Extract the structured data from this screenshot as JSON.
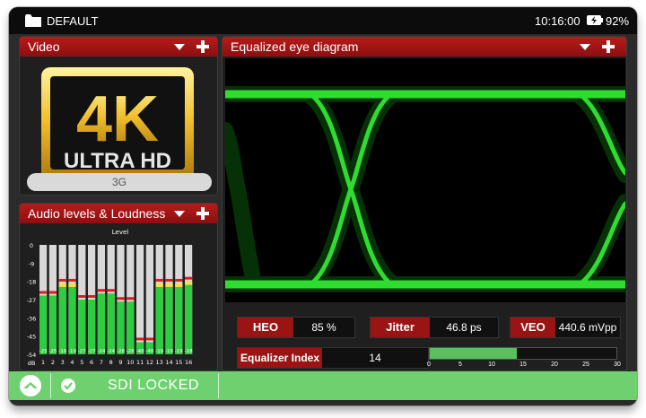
{
  "status": {
    "profile": "DEFAULT",
    "time": "10:16:00",
    "battery": "92%"
  },
  "video": {
    "title": "Video",
    "logo_main": "4K",
    "logo_sub": "ULTRA HD",
    "format": "3G"
  },
  "audio": {
    "title": "Audio levels & Loudness",
    "chart_title": "Level",
    "y_ticks": [
      "0",
      "-9",
      "-18",
      "-27",
      "-36",
      "-45",
      "-54",
      "dB"
    ],
    "channels": [
      {
        "ch": "1",
        "peak": "-25"
      },
      {
        "ch": "2",
        "peak": "-25"
      },
      {
        "ch": "3",
        "peak": "-19"
      },
      {
        "ch": "4",
        "peak": "-19"
      },
      {
        "ch": "5",
        "peak": "-27"
      },
      {
        "ch": "6",
        "peak": "-27"
      },
      {
        "ch": "7",
        "peak": "-24"
      },
      {
        "ch": "8",
        "peak": "-24"
      },
      {
        "ch": "9",
        "peak": "-28"
      },
      {
        "ch": "10",
        "peak": "-28"
      },
      {
        "ch": "11",
        "peak": "-48"
      },
      {
        "ch": "12",
        "peak": "-48"
      },
      {
        "ch": "13",
        "peak": "-19"
      },
      {
        "ch": "14",
        "peak": "-19"
      },
      {
        "ch": "15",
        "peak": "-19"
      },
      {
        "ch": "16",
        "peak": "-18"
      }
    ]
  },
  "eye": {
    "title": "Equalized eye diagram",
    "heo_label": "HEO",
    "heo_value": "85 %",
    "jitter_label": "Jitter",
    "jitter_value": "46.8 ps",
    "veo_label": "VEO",
    "veo_value": "440.6 mVpp",
    "eq_label": "Equalizer Index",
    "eq_value": "14",
    "eq_level": 14,
    "eq_max": 30,
    "eq_ticks": [
      "0",
      "5",
      "10",
      "15",
      "20",
      "25",
      "30"
    ]
  },
  "footer": {
    "lock_status": "SDI LOCKED"
  },
  "colors": {
    "header_red": "#b81b1b",
    "meter_green": "#2ecc40",
    "eye_green": "#33e833",
    "footer_green": "#6ed06e"
  }
}
